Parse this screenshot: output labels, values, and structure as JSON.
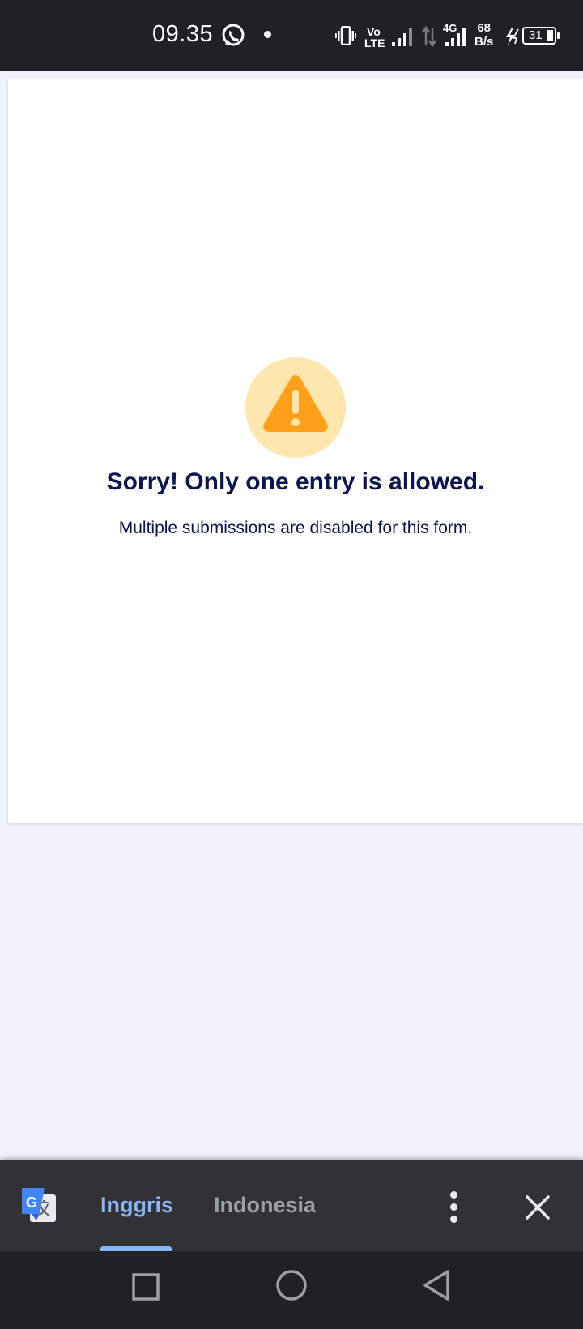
{
  "status_bar": {
    "time": "09.35",
    "network_top": "Vo",
    "network_bottom": "LTE",
    "network_type": "4G",
    "speed_value": "68",
    "speed_unit": "B/s",
    "battery": "31",
    "icons": [
      "whatsapp-icon",
      "notification-dot",
      "vibrate-icon",
      "volte-icon",
      "signal-icon",
      "data-arrows-icon",
      "signal-4g-icon",
      "charging-icon",
      "battery-icon"
    ]
  },
  "message": {
    "icon": "warning-icon",
    "title": "Sorry! Only one entry is allowed.",
    "subtitle": "Multiple submissions are disabled for this form.",
    "colors": {
      "title": "#0a1551",
      "icon_bg": "#fee6af",
      "icon_fg": "#ff9f1a"
    }
  },
  "translate_bar": {
    "logo": "google-translate-icon",
    "source_language": "Inggris",
    "target_language": "Indonesia",
    "more_icon": "more-vert-icon",
    "close_icon": "close-icon",
    "colors": {
      "active": "#8ab4f8",
      "inactive": "#9aa0a6",
      "bg": "#323235"
    }
  },
  "nav_bar": {
    "buttons": [
      "recents-icon",
      "home-icon",
      "back-icon"
    ]
  }
}
